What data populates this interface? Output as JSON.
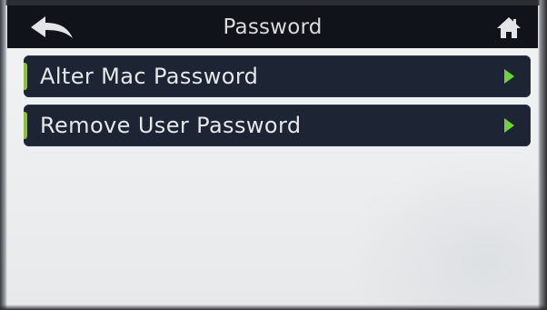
{
  "header": {
    "title": "Password",
    "back_icon": "back-arrow-icon",
    "home_icon": "home-icon"
  },
  "menu": {
    "items": [
      {
        "label": "Alter Mac Password",
        "icon": "play-arrow-icon"
      },
      {
        "label": "Remove User Password",
        "icon": "play-arrow-icon"
      }
    ]
  },
  "colors": {
    "titlebar_bg": "#11131a",
    "item_bg": "#1d2535",
    "accent_green": "#8fbf3c",
    "arrow_green": "#6fd43a",
    "screen_bg": "#eceeef"
  }
}
